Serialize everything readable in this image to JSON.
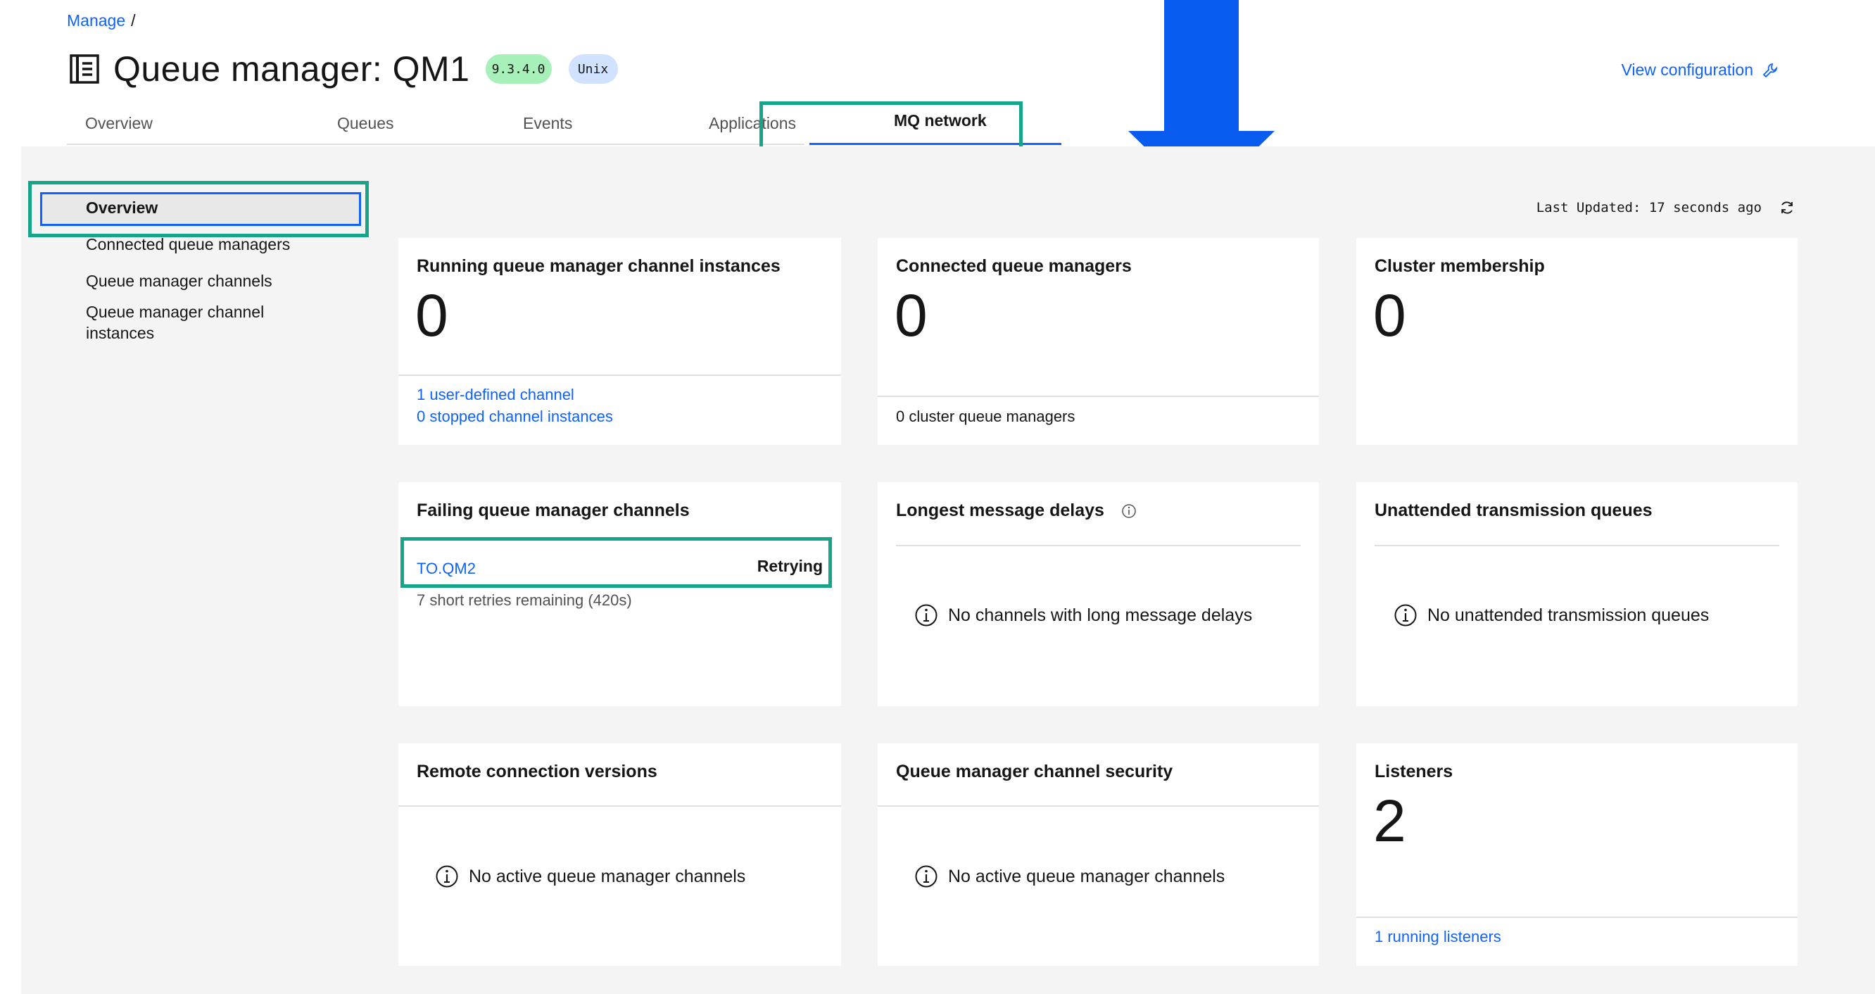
{
  "breadcrumb": {
    "parent": "Manage",
    "separator": "/"
  },
  "header": {
    "title": "Queue manager: QM1",
    "version_tag": "9.3.4.0",
    "os_tag": "Unix",
    "view_configuration": "View configuration",
    "title_icon": "document-icon",
    "config_icon": "wrench-icon"
  },
  "tabs": [
    {
      "label": "Overview"
    },
    {
      "label": "Queues"
    },
    {
      "label": "Events"
    },
    {
      "label": "Applications"
    },
    {
      "label": "MQ network",
      "selected": true
    }
  ],
  "subnav": {
    "items": [
      {
        "label": "Overview",
        "selected": true
      },
      {
        "label": "Connected queue managers"
      },
      {
        "label": "Queue manager channels"
      },
      {
        "label": "Queue manager channel instances",
        "line1": "Queue manager channel",
        "line2": "instances"
      }
    ]
  },
  "last_updated": "Last Updated: 17 seconds ago",
  "cards": {
    "running_instances": {
      "title": "Running queue manager channel instances",
      "value": "0",
      "link1": "1 user-defined channel",
      "link2": "0 stopped channel instances"
    },
    "connected_qms": {
      "title": "Connected queue managers",
      "value": "0",
      "footer": "0 cluster queue managers"
    },
    "cluster_membership": {
      "title": "Cluster membership",
      "value": "0"
    },
    "failing_channels": {
      "title": "Failing queue manager channels",
      "channel_name": "TO.QM2",
      "status": "Retrying",
      "detail": "7 short retries remaining (420s)"
    },
    "message_delays": {
      "title": "Longest message delays",
      "empty": "No channels with long message delays"
    },
    "unattended_queues": {
      "title": "Unattended transmission queues",
      "empty": "No unattended transmission queues"
    },
    "remote_versions": {
      "title": "Remote connection versions",
      "empty": "No active queue manager channels"
    },
    "channel_security": {
      "title": "Queue manager channel security",
      "empty": "No active queue manager channels"
    },
    "listeners": {
      "title": "Listeners",
      "value": "2",
      "link": "1 running listeners"
    }
  },
  "colors": {
    "link": "#0f62fe",
    "highlight": "#17a589",
    "arrow": "#0a5cf0",
    "version_tag_bg": "#a7f0ba",
    "os_tag_bg": "#d0e2ff",
    "content_bg": "#f4f4f4"
  }
}
